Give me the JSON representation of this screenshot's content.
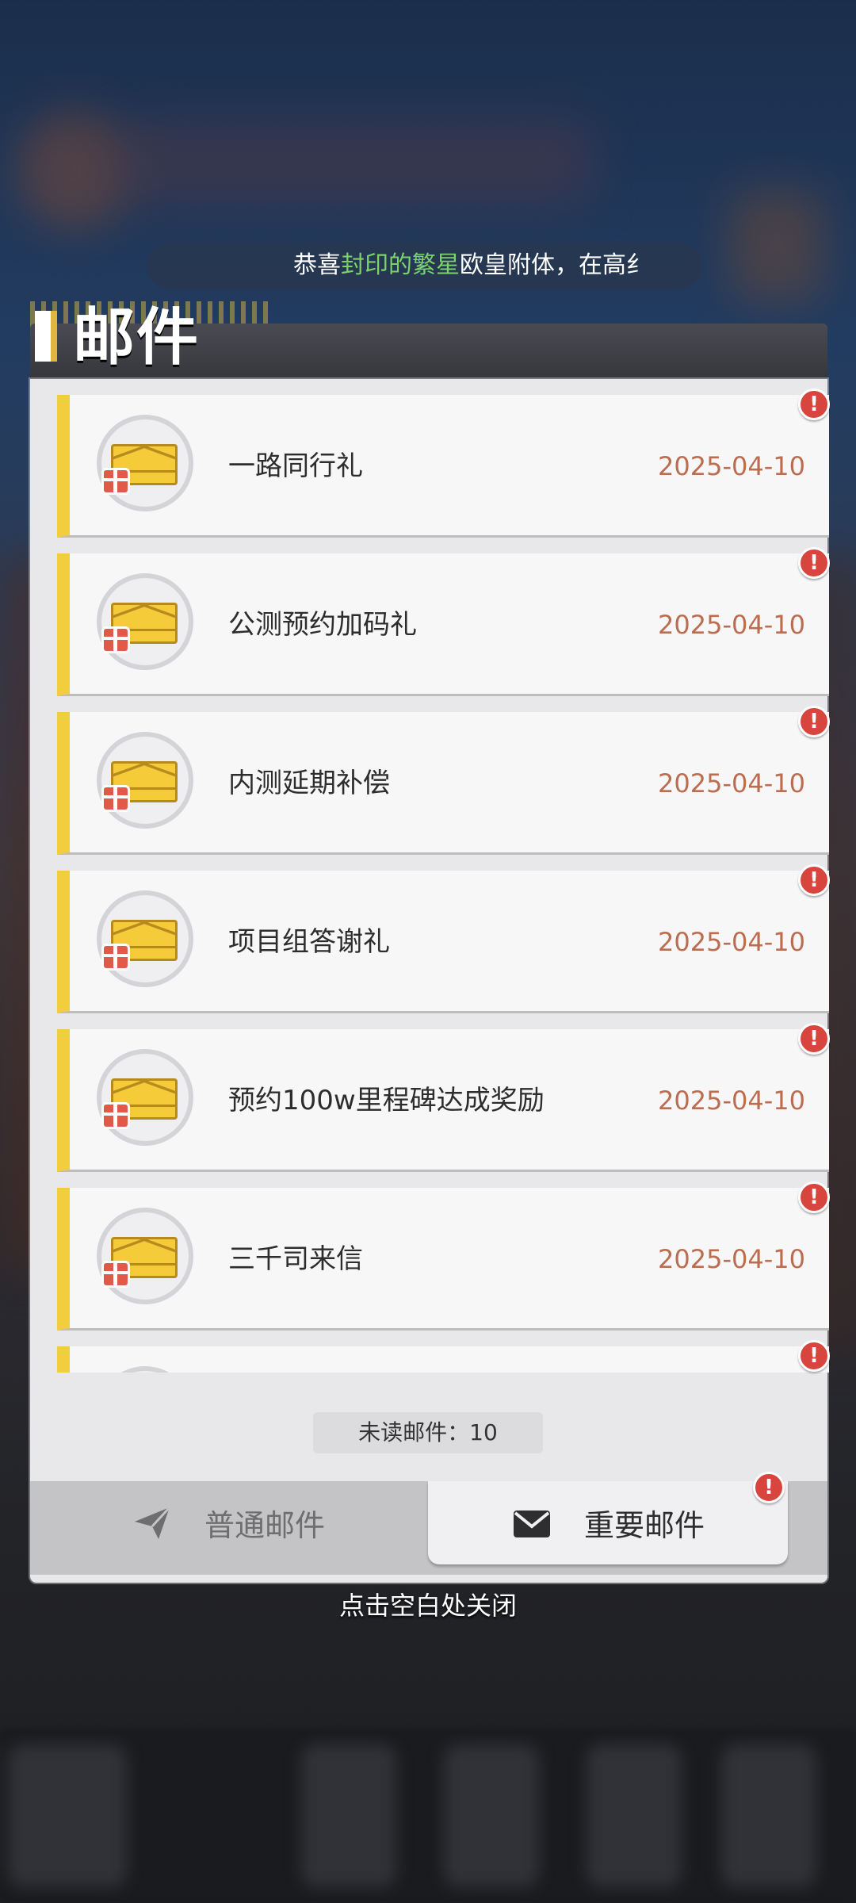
{
  "broadcast": {
    "prefix": "恭喜",
    "highlight": "封印的繁星",
    "suffix": "欧皇附体，在高纟"
  },
  "panel": {
    "title": "邮件"
  },
  "mails": [
    {
      "title": "一路同行礼",
      "date": "2025-04-10"
    },
    {
      "title": "公测预约加码礼",
      "date": "2025-04-10"
    },
    {
      "title": "内测延期补偿",
      "date": "2025-04-10"
    },
    {
      "title": "项目组答谢礼",
      "date": "2025-04-10"
    },
    {
      "title": "预约100w里程碑达成奖励",
      "date": "2025-04-10"
    },
    {
      "title": "三千司来信",
      "date": "2025-04-10"
    }
  ],
  "alert_glyph": "!",
  "unread": {
    "text": "未读邮件：10"
  },
  "tabs": {
    "normal": "普通邮件",
    "important": "重要邮件"
  },
  "close_hint": "点击空白处关闭",
  "colors": {
    "accent_yellow": "#f2cd3e",
    "date_color": "#bc6d4f",
    "alert_red": "#d8453e",
    "highlight_green": "#7cd36b"
  }
}
